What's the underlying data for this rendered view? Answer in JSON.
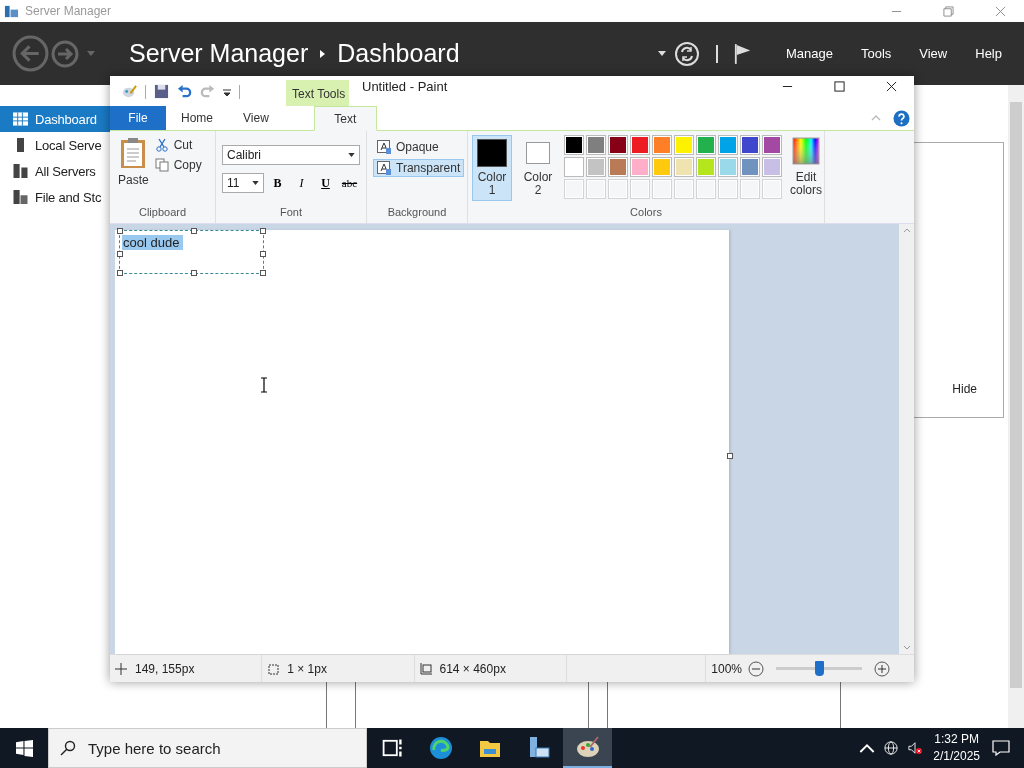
{
  "server_manager": {
    "title": "Server Manager",
    "breadcrumb": [
      "Server Manager",
      "Dashboard"
    ],
    "menu": [
      "Manage",
      "Tools",
      "View",
      "Help"
    ],
    "sidebar": [
      {
        "label": "Dashboard",
        "kind": "dashboard",
        "selected": true
      },
      {
        "label": "Local Serve",
        "kind": "server",
        "selected": false
      },
      {
        "label": "All Servers",
        "kind": "servers",
        "selected": false
      },
      {
        "label": "File and Stc",
        "kind": "storage",
        "selected": false
      }
    ],
    "hide_button": "Hide"
  },
  "paint": {
    "title": "Untitled - Paint",
    "contextual_tab": "Text Tools",
    "tabs": [
      {
        "label": "File",
        "kind": "file",
        "selected": false
      },
      {
        "label": "Home",
        "kind": "tab",
        "selected": false
      },
      {
        "label": "View",
        "kind": "tab",
        "selected": false
      },
      {
        "label": "Text",
        "kind": "tab",
        "selected": true
      }
    ],
    "clipboard": {
      "label": "Clipboard",
      "paste": "Paste",
      "cut": "Cut",
      "copy": "Copy"
    },
    "font": {
      "label": "Font",
      "family": "Calibri",
      "size": "11",
      "styles": [
        {
          "label": "B",
          "kind": "bold"
        },
        {
          "label": "I",
          "kind": "italic"
        },
        {
          "label": "U",
          "kind": "underline"
        },
        {
          "label": "abc",
          "kind": "strike"
        }
      ]
    },
    "background": {
      "label": "Background",
      "options": [
        {
          "label": "Opaque",
          "selected": false
        },
        {
          "label": "Transparent",
          "selected": true
        }
      ]
    },
    "colors": {
      "label": "Colors",
      "current": [
        {
          "label": "Color 1",
          "color": "#000000",
          "selected": true
        },
        {
          "label": "Color 2",
          "color": "#ffffff",
          "selected": false
        }
      ],
      "palette": [
        {
          "kind": "swatch",
          "color": "#000000"
        },
        {
          "kind": "swatch",
          "color": "#7f7f7f"
        },
        {
          "kind": "swatch",
          "color": "#880015"
        },
        {
          "kind": "swatch",
          "color": "#ed1c24"
        },
        {
          "kind": "swatch",
          "color": "#ff7f27"
        },
        {
          "kind": "swatch",
          "color": "#fff200"
        },
        {
          "kind": "swatch",
          "color": "#22b14c"
        },
        {
          "kind": "swatch",
          "color": "#00a2e8"
        },
        {
          "kind": "swatch",
          "color": "#3f48cc"
        },
        {
          "kind": "swatch",
          "color": "#a349a4"
        },
        {
          "kind": "swatch",
          "color": "#ffffff"
        },
        {
          "kind": "swatch",
          "color": "#c3c3c3"
        },
        {
          "kind": "swatch",
          "color": "#b97a57"
        },
        {
          "kind": "swatch",
          "color": "#ffaec9"
        },
        {
          "kind": "swatch",
          "color": "#ffc90e"
        },
        {
          "kind": "swatch",
          "color": "#efe4b0"
        },
        {
          "kind": "swatch",
          "color": "#b5e61d"
        },
        {
          "kind": "swatch",
          "color": "#99d9ea"
        },
        {
          "kind": "swatch",
          "color": "#7092be"
        },
        {
          "kind": "swatch",
          "color": "#c8bfe7"
        },
        {
          "kind": "empty"
        },
        {
          "kind": "empty"
        },
        {
          "kind": "empty"
        },
        {
          "kind": "empty"
        },
        {
          "kind": "empty"
        },
        {
          "kind": "empty"
        },
        {
          "kind": "empty"
        },
        {
          "kind": "empty"
        },
        {
          "kind": "empty"
        },
        {
          "kind": "empty"
        }
      ],
      "edit": "Edit colors"
    },
    "canvas_text": "cool dude",
    "status": {
      "position": "149, 155px",
      "selection": "1 × 1px",
      "size": "614 × 460px",
      "zoom": "100%",
      "zoom_slider": {
        "level": 0.5
      }
    }
  },
  "taskbar": {
    "search_placeholder": "Type here to search",
    "apps": [
      {
        "kind": "taskview",
        "selected": false
      },
      {
        "kind": "browser",
        "selected": false
      },
      {
        "kind": "folder",
        "selected": false
      },
      {
        "kind": "server",
        "selected": false
      },
      {
        "kind": "paint",
        "selected": true
      }
    ],
    "time": "1:32 PM",
    "date": "2/1/2025"
  }
}
